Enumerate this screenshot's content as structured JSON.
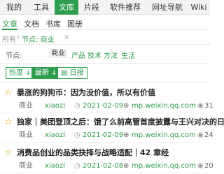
{
  "topnav": {
    "tabs": [
      {
        "label": "我的"
      },
      {
        "label": "工具"
      },
      {
        "label": "文库",
        "active": true
      },
      {
        "label": "片段"
      },
      {
        "label": "软件推荐"
      },
      {
        "label": "网址导航"
      },
      {
        "label": "Wiki"
      }
    ]
  },
  "subtabs": {
    "items": [
      {
        "label": "文章",
        "active": true
      },
      {
        "label": "文档"
      },
      {
        "label": "书库"
      },
      {
        "label": "图册"
      }
    ]
  },
  "breadcrumb": {
    "root": "所有",
    "sep": "›",
    "node": "节点: 商业",
    "close": "×"
  },
  "filters": {
    "label": "节点:",
    "chips": [
      {
        "label": "商业",
        "selected": true
      },
      {
        "label": "产品"
      },
      {
        "label": "技术"
      },
      {
        "label": "方法"
      },
      {
        "label": "生活"
      }
    ]
  },
  "sort": {
    "hot": "热度 ↓",
    "new": "最新 ↓",
    "daily": "▤ 日报"
  },
  "articles": [
    {
      "title": "暴涨的狗狗币：因为没价值，所以有价值",
      "tag": "商业",
      "author": "xiaozi",
      "date": "2021-02-09",
      "source": "mp.weixin.qq.com",
      "views": "31"
    },
    {
      "title": "独家｜美团登顶之后：饿了么前高管首度披露与王兴对决的日子",
      "tag": "商业",
      "author": "xiaozi",
      "date": "2021-02-09",
      "source": "mp.weixin.qq.com",
      "views": "24"
    },
    {
      "title": "消费品创业的品类抉择与战略适配｜42 章经",
      "tag": "商业",
      "author": "xiaozi",
      "date": "2021-02-08",
      "source": "mp.weixin.qq.com",
      "views": "20"
    }
  ],
  "icons": {
    "star": "star-outline-icon",
    "clock": "clock-icon",
    "link": "globe-link-icon",
    "eye": "eye-icon"
  },
  "colors": {
    "accent": "#2e9e4e",
    "star": "#e0a800"
  }
}
